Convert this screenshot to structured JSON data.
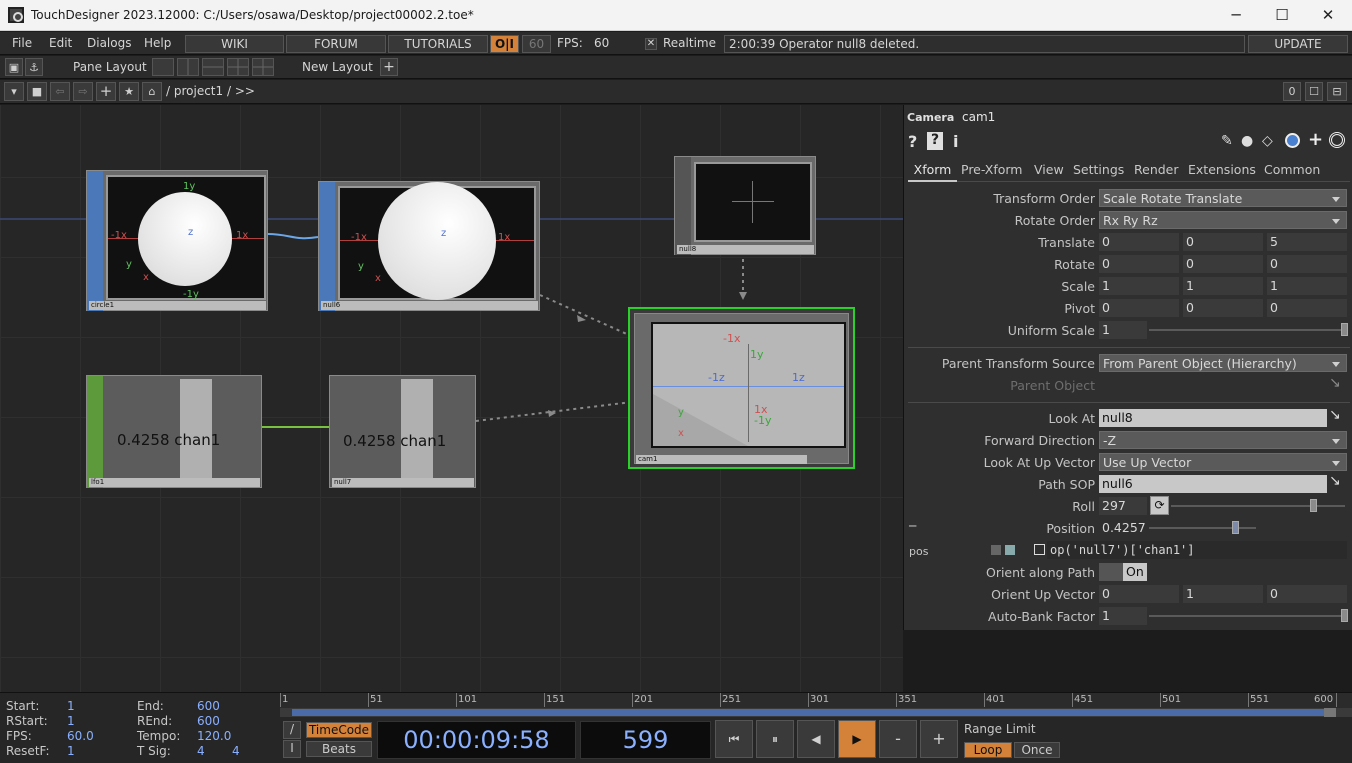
{
  "window": {
    "title": "TouchDesigner 2023.12000: C:/Users/osawa/Desktop/project00002.2.toe*",
    "min": "─",
    "max": "☐",
    "close": "✕"
  },
  "menu": {
    "items": [
      "File",
      "Edit",
      "Dialogs",
      "Help"
    ],
    "wiki": "WIKI",
    "forum": "FORUM",
    "tutorials": "TUTORIALS",
    "oi": "O|I",
    "fps_cap": "60",
    "fps_label": "FPS:",
    "fps_value": "60",
    "realtime_label": "Realtime",
    "status": "2:00:39 Operator null8 deleted.",
    "update": "UPDATE"
  },
  "layout": {
    "pane_layout": "Pane Layout",
    "new_layout": "New Layout",
    "plus": "+"
  },
  "pathbar": {
    "path": "/ project1 / >>",
    "zero": "0"
  },
  "nodes": {
    "circle1": {
      "name": "circle1",
      "ny": "1y",
      "nny": "-1y",
      "nx": "-1x",
      "px": "1x",
      "z": "z",
      "ay": "y",
      "ax": "x"
    },
    "null6": {
      "name": "null6",
      "nx": "-1x",
      "px": "1x",
      "z": "z",
      "ay": "y",
      "ax": "x"
    },
    "null8": {
      "name": "null8"
    },
    "lfo1": {
      "name": "lfo1",
      "value": "0.4258 chan1"
    },
    "null7": {
      "name": "null7",
      "value": "0.4258 chan1"
    },
    "cam1": {
      "name": "cam1",
      "nx": "-1x",
      "y": "1y",
      "lz": "-1z",
      "rz": "1z",
      "px": "1x",
      "ny": "-1y",
      "ay": "y",
      "ax": "x"
    }
  },
  "panel": {
    "type": "Camera",
    "name": "cam1",
    "tabs": [
      "Xform",
      "Pre-Xform",
      "View",
      "Settings",
      "Render",
      "Extensions",
      "Common"
    ],
    "params": {
      "transform_order": {
        "label": "Transform Order",
        "value": "Scale Rotate Translate"
      },
      "rotate_order": {
        "label": "Rotate Order",
        "value": "Rx Ry Rz"
      },
      "translate": {
        "label": "Translate",
        "v": [
          "0",
          "0",
          "5"
        ]
      },
      "rotate": {
        "label": "Rotate",
        "v": [
          "0",
          "0",
          "0"
        ]
      },
      "scale": {
        "label": "Scale",
        "v": [
          "1",
          "1",
          "1"
        ]
      },
      "pivot": {
        "label": "Pivot",
        "v": [
          "0",
          "0",
          "0"
        ]
      },
      "uniform_scale": {
        "label": "Uniform Scale",
        "value": "1"
      },
      "parent_transform_source": {
        "label": "Parent Transform Source",
        "value": "From Parent Object (Hierarchy)"
      },
      "parent_object": {
        "label": "Parent Object"
      },
      "look_at": {
        "label": "Look At",
        "value": "null8"
      },
      "forward_direction": {
        "label": "Forward Direction",
        "value": "-Z"
      },
      "look_at_up_vector": {
        "label": "Look At Up Vector",
        "value": "Use Up Vector"
      },
      "path_sop": {
        "label": "Path SOP",
        "value": "null6"
      },
      "roll": {
        "label": "Roll",
        "value": "297"
      },
      "position": {
        "label": "Position",
        "value": "0.4257",
        "expr_name": "pos",
        "expr": "op('null7')['chan1']"
      },
      "orient_along_path": {
        "label": "Orient along Path",
        "value": "On"
      },
      "orient_up_vector": {
        "label": "Orient Up Vector",
        "v": [
          "0",
          "1",
          "0"
        ]
      },
      "auto_bank": {
        "label": "Auto-Bank Factor",
        "value": "1"
      }
    }
  },
  "timeline": {
    "start_label": "Start:",
    "start": "1",
    "end_label": "End:",
    "end": "600",
    "rstart_label": "RStart:",
    "rstart": "1",
    "rend_label": "REnd:",
    "rend": "600",
    "fps_label": "FPS:",
    "fps": "60.0",
    "tempo_label": "Tempo:",
    "tempo": "120.0",
    "resetf_label": "ResetF:",
    "resetf": "1",
    "tsig_label": "T Sig:",
    "tsig_a": "4",
    "tsig_b": "4",
    "ticks": [
      "1",
      "51",
      "101",
      "151",
      "201",
      "251",
      "301",
      "351",
      "401",
      "451",
      "501",
      "551",
      "600"
    ],
    "timecode": "TimeCode",
    "beats": "Beats",
    "clock": "00:00:09:58",
    "frame": "599",
    "range_limit": "Range Limit",
    "loop": "Loop",
    "once": "Once",
    "btn_first": "⏮",
    "btn_pause": "⏸",
    "btn_back": "◀",
    "btn_play": "▶",
    "btn_minus": "-",
    "btn_plus": "+"
  }
}
